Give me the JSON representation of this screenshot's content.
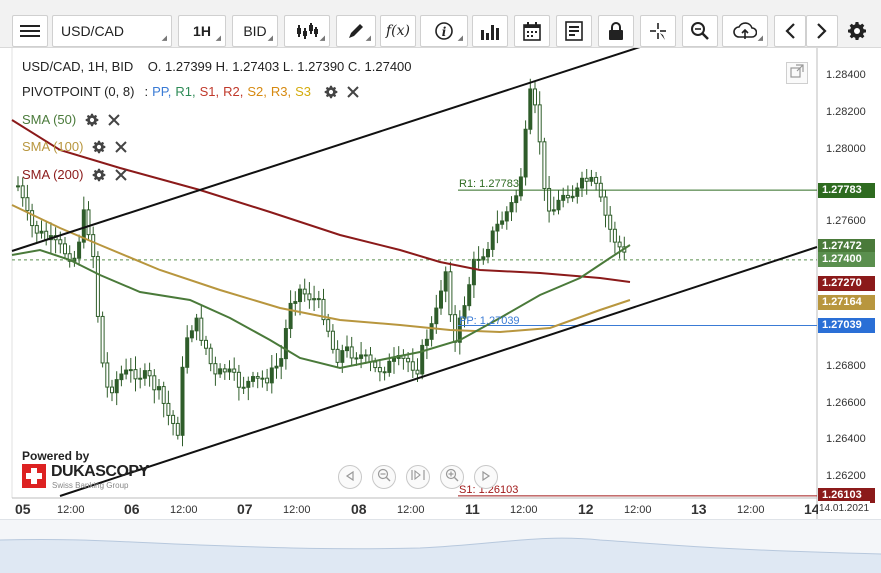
{
  "toolbar": {
    "instrument": "USD/CAD",
    "timeframe": "1H",
    "price_side": "BID",
    "buttons": [
      "menu-icon",
      "instrument-select",
      "timeframe-select",
      "price-side-select",
      "chart-type-icon",
      "drawing-icon",
      "indicator-fx-icon",
      "info-icon",
      "bar-stats-icon",
      "calendar-icon",
      "report-icon",
      "lock-icon",
      "crosshair-icon",
      "zoom-icon",
      "cloud-save-icon",
      "prev-icon",
      "next-icon",
      "settings-icon"
    ]
  },
  "legend": {
    "ohlc": "USD/CAD, 1H, BID    O. 1.27399 H. 1.27403 L. 1.27390 C. 1.27400",
    "pivot_label": "PIVOTPOINT (0, 8)",
    "pivot_sep": ":",
    "pivot_levels": [
      {
        "name": "PP,",
        "color": "#3a7bd5"
      },
      {
        "name": "R1,",
        "color": "#2e8b57"
      },
      {
        "name": "S1,",
        "color": "#c0392b"
      },
      {
        "name": "R2,",
        "color": "#c0392b"
      },
      {
        "name": "S2,",
        "color": "#d68910"
      },
      {
        "name": "R3,",
        "color": "#d68910"
      },
      {
        "name": "S3",
        "color": "#d4ac0d"
      }
    ],
    "sma50": "SMA (50)",
    "sma100": "SMA (100)",
    "sma200": "SMA (200)"
  },
  "colors": {
    "sma50": "#4a7a3a",
    "sma100": "#b8963e",
    "sma200": "#8b1a1a",
    "candle": "#2f5d2a",
    "pp": "#3a7bd5",
    "r1": "#2e6b20",
    "s1": "#a01818",
    "trend": "#111111"
  },
  "price_axis": {
    "labels": [
      "1.28400",
      "1.28200",
      "1.28000",
      "1.27600",
      "1.26800",
      "1.26600",
      "1.26400",
      "1.26200"
    ],
    "tags": [
      {
        "value": "1.27783",
        "color": "#2e6b20"
      },
      {
        "value": "1.27472",
        "color": "#4a7a3a"
      },
      {
        "value": "1.27400",
        "color": "#5a8f4e"
      },
      {
        "value": "1.27270",
        "color": "#8b1a1a"
      },
      {
        "value": "1.27164",
        "color": "#b8963e"
      },
      {
        "value": "1.27039",
        "color": "#2a6fd6"
      },
      {
        "value": "1.26103",
        "color": "#8b1a1a"
      }
    ]
  },
  "pivots": {
    "r1": "R1: 1.27783",
    "pp": "PP: 1.27039",
    "s1": "S1: 1.26103"
  },
  "time_axis": {
    "labels": [
      {
        "text": "05",
        "bold": true
      },
      {
        "text": "12:00",
        "bold": false
      },
      {
        "text": "06",
        "bold": true
      },
      {
        "text": "12:00",
        "bold": false
      },
      {
        "text": "07",
        "bold": true
      },
      {
        "text": "12:00",
        "bold": false
      },
      {
        "text": "08",
        "bold": true
      },
      {
        "text": "12:00",
        "bold": false
      },
      {
        "text": "11",
        "bold": true
      },
      {
        "text": "12:00",
        "bold": false
      },
      {
        "text": "12",
        "bold": true
      },
      {
        "text": "12:00",
        "bold": false
      },
      {
        "text": "13",
        "bold": true
      },
      {
        "text": "12:00",
        "bold": false
      },
      {
        "text": "14",
        "bold": true
      }
    ],
    "current_date": "14.01.2021"
  },
  "branding": {
    "powered_by": "Powered by",
    "bank": "DUKASCOPY",
    "tagline": "Swiss Banking Group"
  },
  "chart_data": {
    "type": "candlestick",
    "instrument": "USD/CAD",
    "timeframe": "1H",
    "ylim": [
      1.2612,
      1.2852
    ],
    "pivot_levels": {
      "R1": 1.27783,
      "PP": 1.27039,
      "S1": 1.26103
    },
    "last_price": 1.274,
    "sma_values_last": {
      "SMA50": 1.27472,
      "SMA100": 1.27164,
      "SMA200": 1.2727
    }
  }
}
